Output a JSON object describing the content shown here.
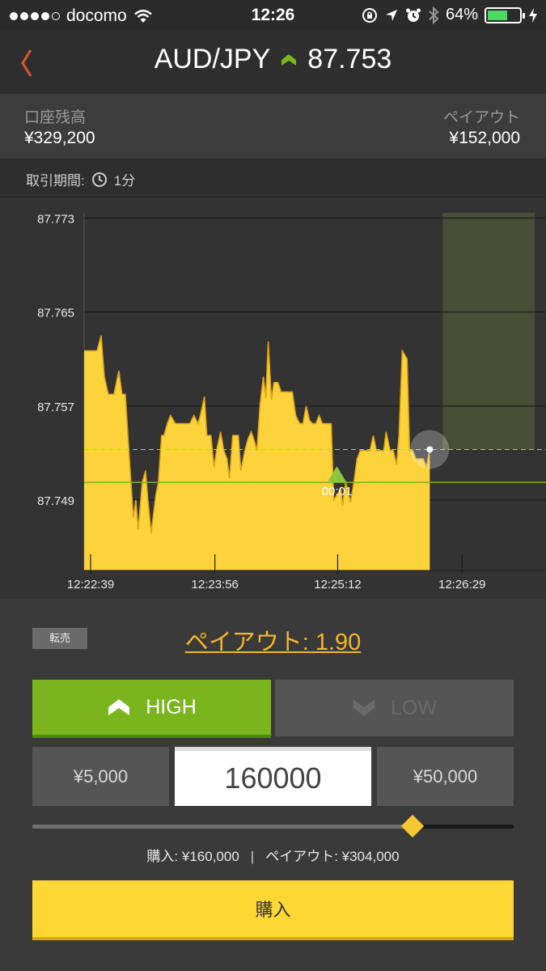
{
  "status_bar": {
    "carrier": "docomo",
    "time": "12:26",
    "battery_percent": "64%",
    "battery_level": 0.64,
    "signal_dots_filled": 4,
    "signal_dots_total": 5
  },
  "header": {
    "pair": "AUD/JPY",
    "price": "87.753",
    "trend": "up",
    "trend_color": "#7ab51d"
  },
  "account": {
    "balance_label": "口座残高",
    "balance_value": "¥329,200",
    "payout_label": "ペイアウト",
    "payout_value": "¥152,000"
  },
  "period": {
    "label": "取引期間:",
    "value": "1分"
  },
  "chart_data": {
    "type": "area",
    "ylim": [
      87.743,
      87.774
    ],
    "y_ticks": [
      "87.773",
      "87.765",
      "87.757",
      "87.749"
    ],
    "y_tick_values": [
      87.773,
      87.765,
      87.757,
      87.749
    ],
    "x_ticks": [
      "12:22:39",
      "12:23:56",
      "12:25:12",
      "12:26:29"
    ],
    "x_tick_seconds": [
      0,
      77,
      153,
      230
    ],
    "x_range_seconds": [
      -4,
      282
    ],
    "fill_color": "#fdd33b",
    "line_color": "#e0a218",
    "entry_rate": 87.7505,
    "entry_line_color": "#7ab51d",
    "current_rate": 87.7533,
    "entry_marker_time": 152.5,
    "entry_marker_label": "00:01",
    "expiry_zone_seconds": [
      218,
      275
    ],
    "series": [
      {
        "t": -4,
        "v": 87.7617
      },
      {
        "t": 4,
        "v": 87.7617
      },
      {
        "t": 6.5,
        "v": 87.763
      },
      {
        "t": 8.5,
        "v": 87.7595
      },
      {
        "t": 11,
        "v": 87.758
      },
      {
        "t": 14.5,
        "v": 87.758
      },
      {
        "t": 17.5,
        "v": 87.76
      },
      {
        "t": 19.5,
        "v": 87.758
      },
      {
        "t": 21.5,
        "v": 87.758
      },
      {
        "t": 24.5,
        "v": 87.7515
      },
      {
        "t": 26.5,
        "v": 87.7475
      },
      {
        "t": 28,
        "v": 87.749
      },
      {
        "t": 29.5,
        "v": 87.7465
      },
      {
        "t": 32,
        "v": 87.7505
      },
      {
        "t": 34,
        "v": 87.7515
      },
      {
        "t": 35.5,
        "v": 87.749
      },
      {
        "t": 37.5,
        "v": 87.7462
      },
      {
        "t": 40.5,
        "v": 87.7495
      },
      {
        "t": 42,
        "v": 87.7505
      },
      {
        "t": 44,
        "v": 87.7545
      },
      {
        "t": 45.5,
        "v": 87.7545
      },
      {
        "t": 47.5,
        "v": 87.7555
      },
      {
        "t": 49.5,
        "v": 87.7562
      },
      {
        "t": 52.5,
        "v": 87.7555
      },
      {
        "t": 55.5,
        "v": 87.7555
      },
      {
        "t": 58.5,
        "v": 87.7555
      },
      {
        "t": 61.5,
        "v": 87.7555
      },
      {
        "t": 64,
        "v": 87.7562
      },
      {
        "t": 66.5,
        "v": 87.7555
      },
      {
        "t": 68,
        "v": 87.7562
      },
      {
        "t": 70.5,
        "v": 87.7578
      },
      {
        "t": 72,
        "v": 87.7545
      },
      {
        "t": 74.5,
        "v": 87.7545
      },
      {
        "t": 76.5,
        "v": 87.7518
      },
      {
        "t": 78,
        "v": 87.7532
      },
      {
        "t": 80.5,
        "v": 87.7548
      },
      {
        "t": 82.5,
        "v": 87.7532
      },
      {
        "t": 84.5,
        "v": 87.7525
      },
      {
        "t": 86,
        "v": 87.7508
      },
      {
        "t": 88,
        "v": 87.7545
      },
      {
        "t": 91.5,
        "v": 87.7545
      },
      {
        "t": 93,
        "v": 87.7515
      },
      {
        "t": 95.5,
        "v": 87.7532
      },
      {
        "t": 97.5,
        "v": 87.7542
      },
      {
        "t": 99.5,
        "v": 87.7548
      },
      {
        "t": 101.5,
        "v": 87.754
      },
      {
        "t": 103,
        "v": 87.7532
      },
      {
        "t": 105,
        "v": 87.7572
      },
      {
        "t": 107,
        "v": 87.7595
      },
      {
        "t": 108.5,
        "v": 87.7577
      },
      {
        "t": 110,
        "v": 87.7625
      },
      {
        "t": 112,
        "v": 87.7575
      },
      {
        "t": 113.5,
        "v": 87.759
      },
      {
        "t": 116,
        "v": 87.759
      },
      {
        "t": 118,
        "v": 87.7582
      },
      {
        "t": 120.5,
        "v": 87.7582
      },
      {
        "t": 122.5,
        "v": 87.7582
      },
      {
        "t": 125,
        "v": 87.7582
      },
      {
        "t": 127,
        "v": 87.7562
      },
      {
        "t": 129.5,
        "v": 87.7555
      },
      {
        "t": 131.5,
        "v": 87.7555
      },
      {
        "t": 133.5,
        "v": 87.757
      },
      {
        "t": 135.5,
        "v": 87.7558
      },
      {
        "t": 137.5,
        "v": 87.7555
      },
      {
        "t": 139.5,
        "v": 87.7555
      },
      {
        "t": 141.5,
        "v": 87.7562
      },
      {
        "t": 143.5,
        "v": 87.7555
      },
      {
        "t": 146.5,
        "v": 87.7555
      },
      {
        "t": 149,
        "v": 87.7555
      },
      {
        "t": 150.5,
        "v": 87.749
      },
      {
        "t": 151.5,
        "v": 87.7492
      },
      {
        "t": 155,
        "v": 87.75
      },
      {
        "t": 156,
        "v": 87.7485
      },
      {
        "t": 158,
        "v": 87.7505
      },
      {
        "t": 161,
        "v": 87.7488
      },
      {
        "t": 163,
        "v": 87.7505
      },
      {
        "t": 165,
        "v": 87.7525
      },
      {
        "t": 167,
        "v": 87.7532
      },
      {
        "t": 170.5,
        "v": 87.7532
      },
      {
        "t": 173,
        "v": 87.7532
      },
      {
        "t": 175,
        "v": 87.7545
      },
      {
        "t": 177,
        "v": 87.7532
      },
      {
        "t": 179.5,
        "v": 87.7532
      },
      {
        "t": 181.5,
        "v": 87.7532
      },
      {
        "t": 183,
        "v": 87.7548
      },
      {
        "t": 185.5,
        "v": 87.7532
      },
      {
        "t": 187.5,
        "v": 87.7532
      },
      {
        "t": 189.5,
        "v": 87.752
      },
      {
        "t": 191,
        "v": 87.7545
      },
      {
        "t": 193,
        "v": 87.7617
      },
      {
        "t": 196,
        "v": 87.761
      },
      {
        "t": 197.5,
        "v": 87.7532
      },
      {
        "t": 199.5,
        "v": 87.7532
      },
      {
        "t": 201.5,
        "v": 87.7525
      },
      {
        "t": 203,
        "v": 87.7525
      },
      {
        "t": 206,
        "v": 87.7525
      },
      {
        "t": 208,
        "v": 87.7518
      },
      {
        "t": 210,
        "v": 87.7533
      }
    ]
  },
  "trade": {
    "resell_label": "転売",
    "payout_rate_label": "ペイアウト: 1.90",
    "high_label": "HIGH",
    "low_label": "LOW",
    "amount_left": "¥5,000",
    "amount_value": "160000",
    "amount_right": "¥50,000",
    "slider_level": 0.79,
    "summary_purchase": "購入: ¥160,000",
    "summary_separator": "|",
    "summary_payout": "ペイアウト: ¥304,000",
    "buy_label": "購入"
  }
}
